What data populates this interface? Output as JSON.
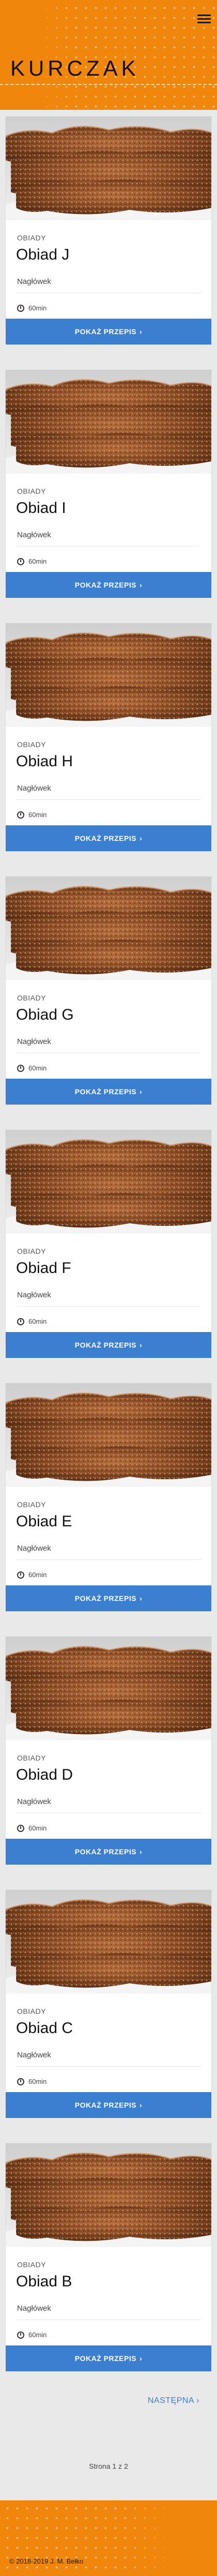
{
  "header": {
    "title": "KURCZAK"
  },
  "menu_icon": "hamburger-menu-icon",
  "cards": [
    {
      "category": "OBIADY",
      "title": "Obiad J",
      "subtitle": "Nagłówek",
      "time": "60min",
      "button": "POKAŻ PRZEPIS"
    },
    {
      "category": "OBIADY",
      "title": "Obiad I",
      "subtitle": "Nagłówek",
      "time": "60min",
      "button": "POKAŻ PRZEPIS"
    },
    {
      "category": "OBIADY",
      "title": "Obiad H",
      "subtitle": "Nagłówek",
      "time": "60min",
      "button": "POKAŻ PRZEPIS"
    },
    {
      "category": "OBIADY",
      "title": "Obiad G",
      "subtitle": "Nagłówek",
      "time": "60min",
      "button": "POKAŻ PRZEPIS"
    },
    {
      "category": "OBIADY",
      "title": "Obiad F",
      "subtitle": "Nagłówek",
      "time": "60min",
      "button": "POKAŻ PRZEPIS"
    },
    {
      "category": "OBIADY",
      "title": "Obiad E",
      "subtitle": "Nagłówek",
      "time": "60min",
      "button": "POKAŻ PRZEPIS"
    },
    {
      "category": "OBIADY",
      "title": "Obiad D",
      "subtitle": "Nagłówek",
      "time": "60min",
      "button": "POKAŻ PRZEPIS"
    },
    {
      "category": "OBIADY",
      "title": "Obiad C",
      "subtitle": "Nagłówek",
      "time": "60min",
      "button": "POKAŻ PRZEPIS"
    },
    {
      "category": "OBIADY",
      "title": "Obiad B",
      "subtitle": "Nagłówek",
      "time": "60min",
      "button": "POKAŻ PRZEPIS"
    }
  ],
  "pagination": {
    "next": "NASTĘPNA",
    "info": "Strona 1 z 2"
  },
  "footer": {
    "copyright": "© 2018-2019 J. M. Bełko"
  },
  "colors": {
    "brand": "#f0860c",
    "button": "#3a7fd0",
    "background": "#e9e9e9"
  }
}
